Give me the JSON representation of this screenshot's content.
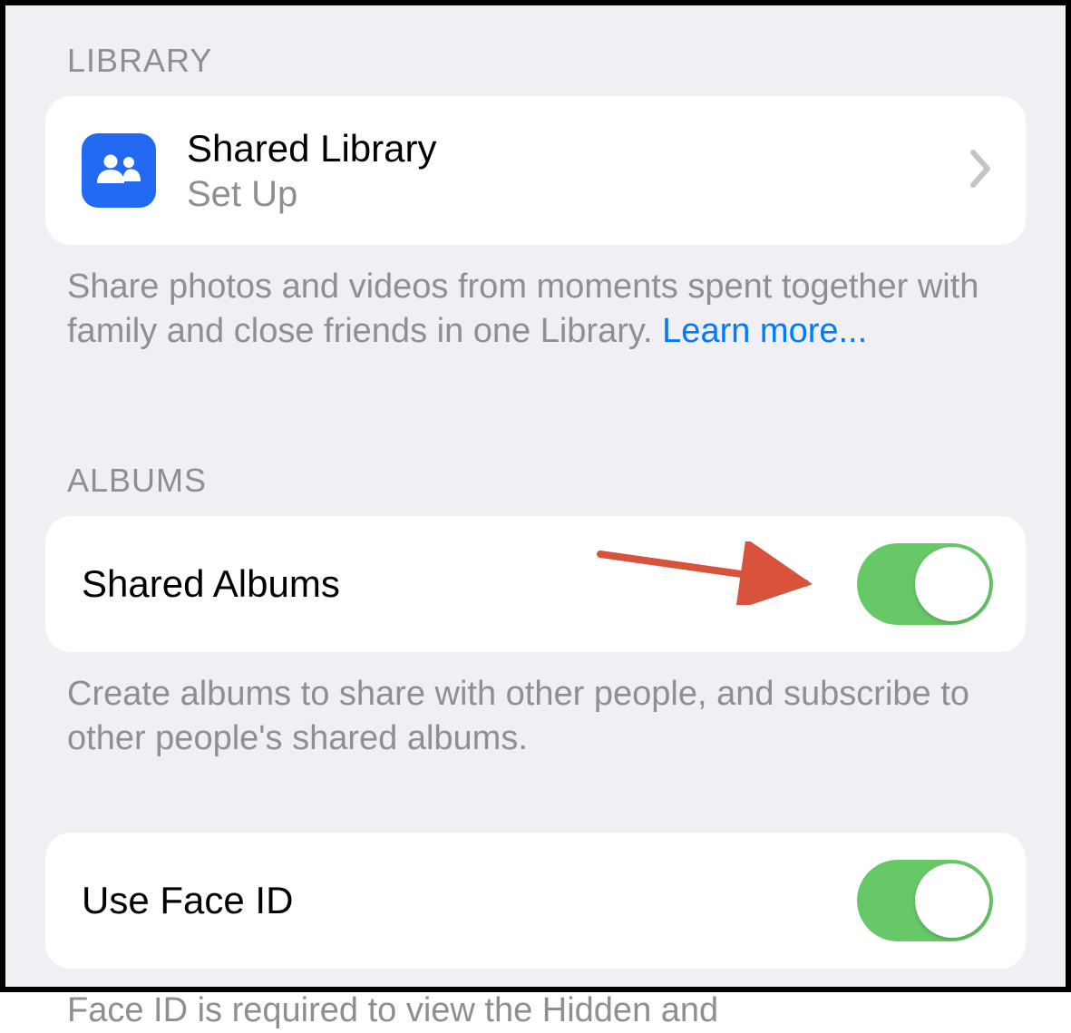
{
  "library": {
    "header": "LIBRARY",
    "shared_library": {
      "title": "Shared Library",
      "subtitle": "Set Up"
    },
    "footer_text": "Share photos and videos from moments spent together with family and close friends in one Library. ",
    "footer_link": "Learn more..."
  },
  "albums": {
    "header": "ALBUMS",
    "shared_albums_label": "Shared Albums",
    "footer_text": "Create albums to share with other people, and subscribe to other people's shared albums."
  },
  "faceid": {
    "label": "Use Face ID",
    "footer_text": "Face ID is required to view the Hidden and"
  }
}
